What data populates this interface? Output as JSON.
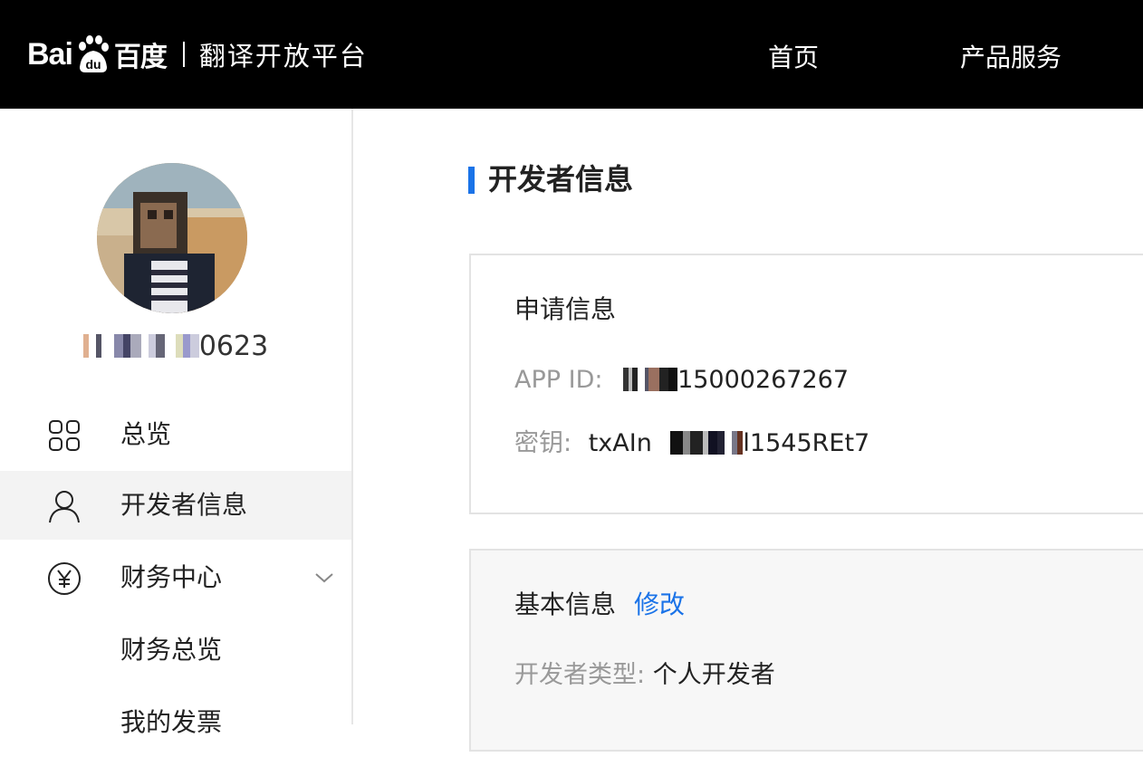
{
  "header": {
    "logo_text": "Bai",
    "logo_cn": "百度",
    "platform_title": "翻译开放平台",
    "nav": [
      {
        "label": "首页"
      },
      {
        "label": "产品服务"
      }
    ]
  },
  "sidebar": {
    "username_suffix": "0623",
    "items": [
      {
        "label": "总览",
        "icon": "grid-icon"
      },
      {
        "label": "开发者信息",
        "icon": "user-icon",
        "active": true
      },
      {
        "label": "财务中心",
        "icon": "yen-icon",
        "expandable": true
      },
      {
        "label": "财务总览"
      },
      {
        "label": "我的发票"
      }
    ]
  },
  "main": {
    "title": "开发者信息",
    "application_info": {
      "heading": "申请信息",
      "app_id_label": "APP ID:",
      "app_id_visible": "15000267267",
      "secret_label": "密钥:",
      "secret_prefix": "txAIn",
      "secret_suffix": "l1545REt7"
    },
    "basic_info": {
      "heading": "基本信息",
      "edit_label": "修改",
      "dev_type_label": "开发者类型:",
      "dev_type_value": "个人开发者"
    }
  },
  "colors": {
    "header_bg": "#000000",
    "accent": "#1a73e8",
    "active_item_bg": "#f3f3f3"
  }
}
